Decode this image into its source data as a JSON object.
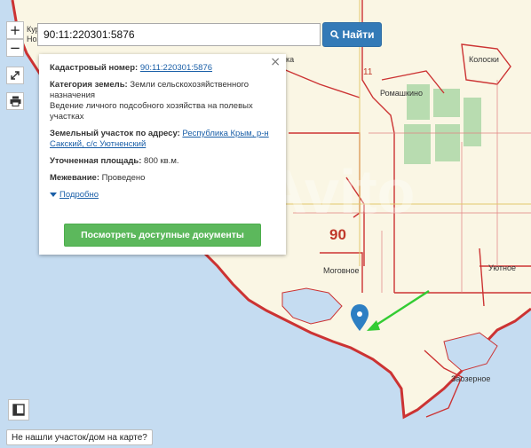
{
  "search": {
    "value": "90:11:220301:5876",
    "button_label": "Найти"
  },
  "controls": {
    "zoom_in": "+",
    "zoom_out": "−"
  },
  "popup": {
    "cadastral_label": "Кадастровый номер:",
    "cadastral_value": "90:11:220301:5876",
    "category_label": "Категория земель:",
    "category_value": "Земли сельскохозяйственного назначения",
    "usage_value": "Ведение личного подсобного хозяйства на полевых участках",
    "address_label": "Земельный участок по адресу:",
    "address_value": "Республика Крым, р-н Сакский, с/с Уютненский",
    "area_label": "Уточненная площадь:",
    "area_value": "800 кв.м.",
    "survey_label": "Межевание:",
    "survey_value": "Проведено",
    "more_label": "Подробно",
    "docs_button": "Посмотреть доступные документы",
    "close": "×"
  },
  "map": {
    "places": {
      "kolosky": "Колоски",
      "romashkino": "Ромашкино",
      "mogochnoe": "Моговное",
      "uyutnoe": "Уютное",
      "zaozernoe": "Заозерное",
      "top_left": "Курс",
      "top_left2": "Ноз",
      "top_mid": "ка"
    },
    "district_number": "90",
    "block_number": "11"
  },
  "footer": {
    "not_found": "Не нашли участок/дом на карте?"
  },
  "colors": {
    "sea": "#c5dcf1",
    "land": "#faf6e4",
    "boundary": "#cc3333",
    "field": "#b8dcb0",
    "arrow": "#33cc33",
    "marker": "#2d7fc3"
  }
}
